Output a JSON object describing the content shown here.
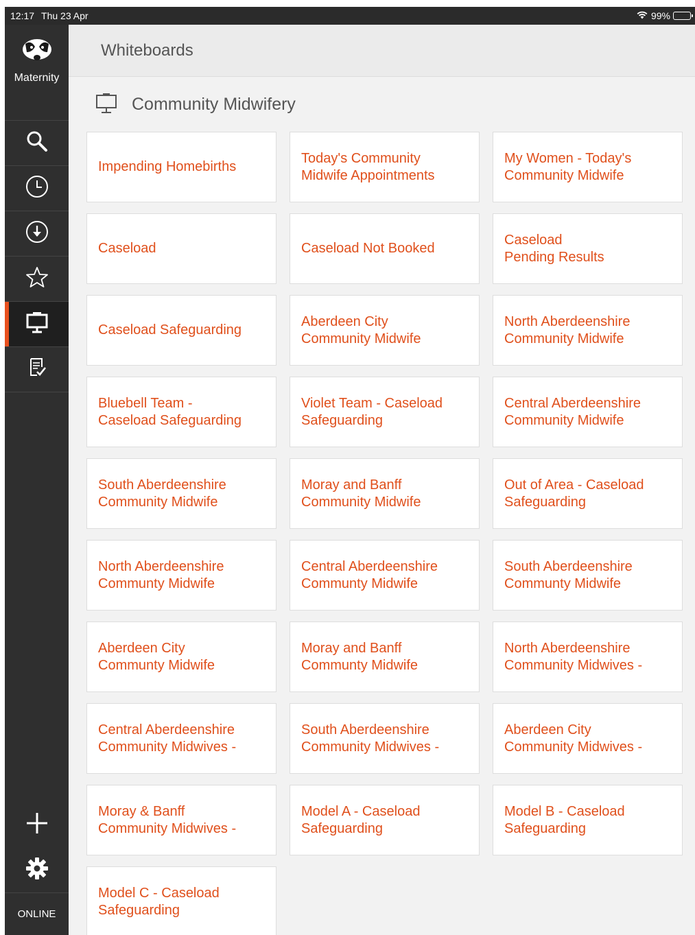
{
  "status_bar": {
    "time": "12:17",
    "date": "Thu 23 Apr",
    "battery": "99%"
  },
  "sidebar": {
    "app_name": "Maternity",
    "status": "ONLINE",
    "accent_color": "#e8501e"
  },
  "header": {
    "title": "Whiteboards"
  },
  "section": {
    "title": "Community Midwifery"
  },
  "tiles": [
    "Impending Homebirths",
    "Today's Community\nMidwife Appointments",
    "My Women - Today's\nCommunity Midwife",
    "Caseload",
    "Caseload Not Booked",
    "Caseload\nPending Results",
    "Caseload Safeguarding",
    "Aberdeen City\nCommunity Midwife",
    "North Aberdeenshire\nCommunity Midwife",
    "Bluebell Team -\nCaseload Safeguarding",
    "Violet Team - Caseload\nSafeguarding",
    "Central Aberdeenshire\nCommunity Midwife",
    "South Aberdeenshire\nCommunity Midwife",
    "Moray and Banff\nCommunity Midwife",
    "Out of Area - Caseload\nSafeguarding",
    "North Aberdeenshire\nCommunty Midwife",
    "Central Aberdeenshire\nCommunty Midwife",
    "South Aberdeenshire\nCommunty Midwife",
    "Aberdeen City\nCommunty Midwife",
    "Moray and Banff\nCommunty Midwife",
    "North Aberdeenshire\nCommunity Midwives -",
    "Central Aberdeenshire\nCommunity Midwives -",
    "South Aberdeenshire\nCommunity Midwives -",
    "Aberdeen City\nCommunity Midwives -",
    "Moray & Banff\nCommunity Midwives -",
    "Model A - Caseload\nSafeguarding",
    "Model B - Caseload\nSafeguarding",
    "Model C - Caseload\nSafeguarding"
  ]
}
